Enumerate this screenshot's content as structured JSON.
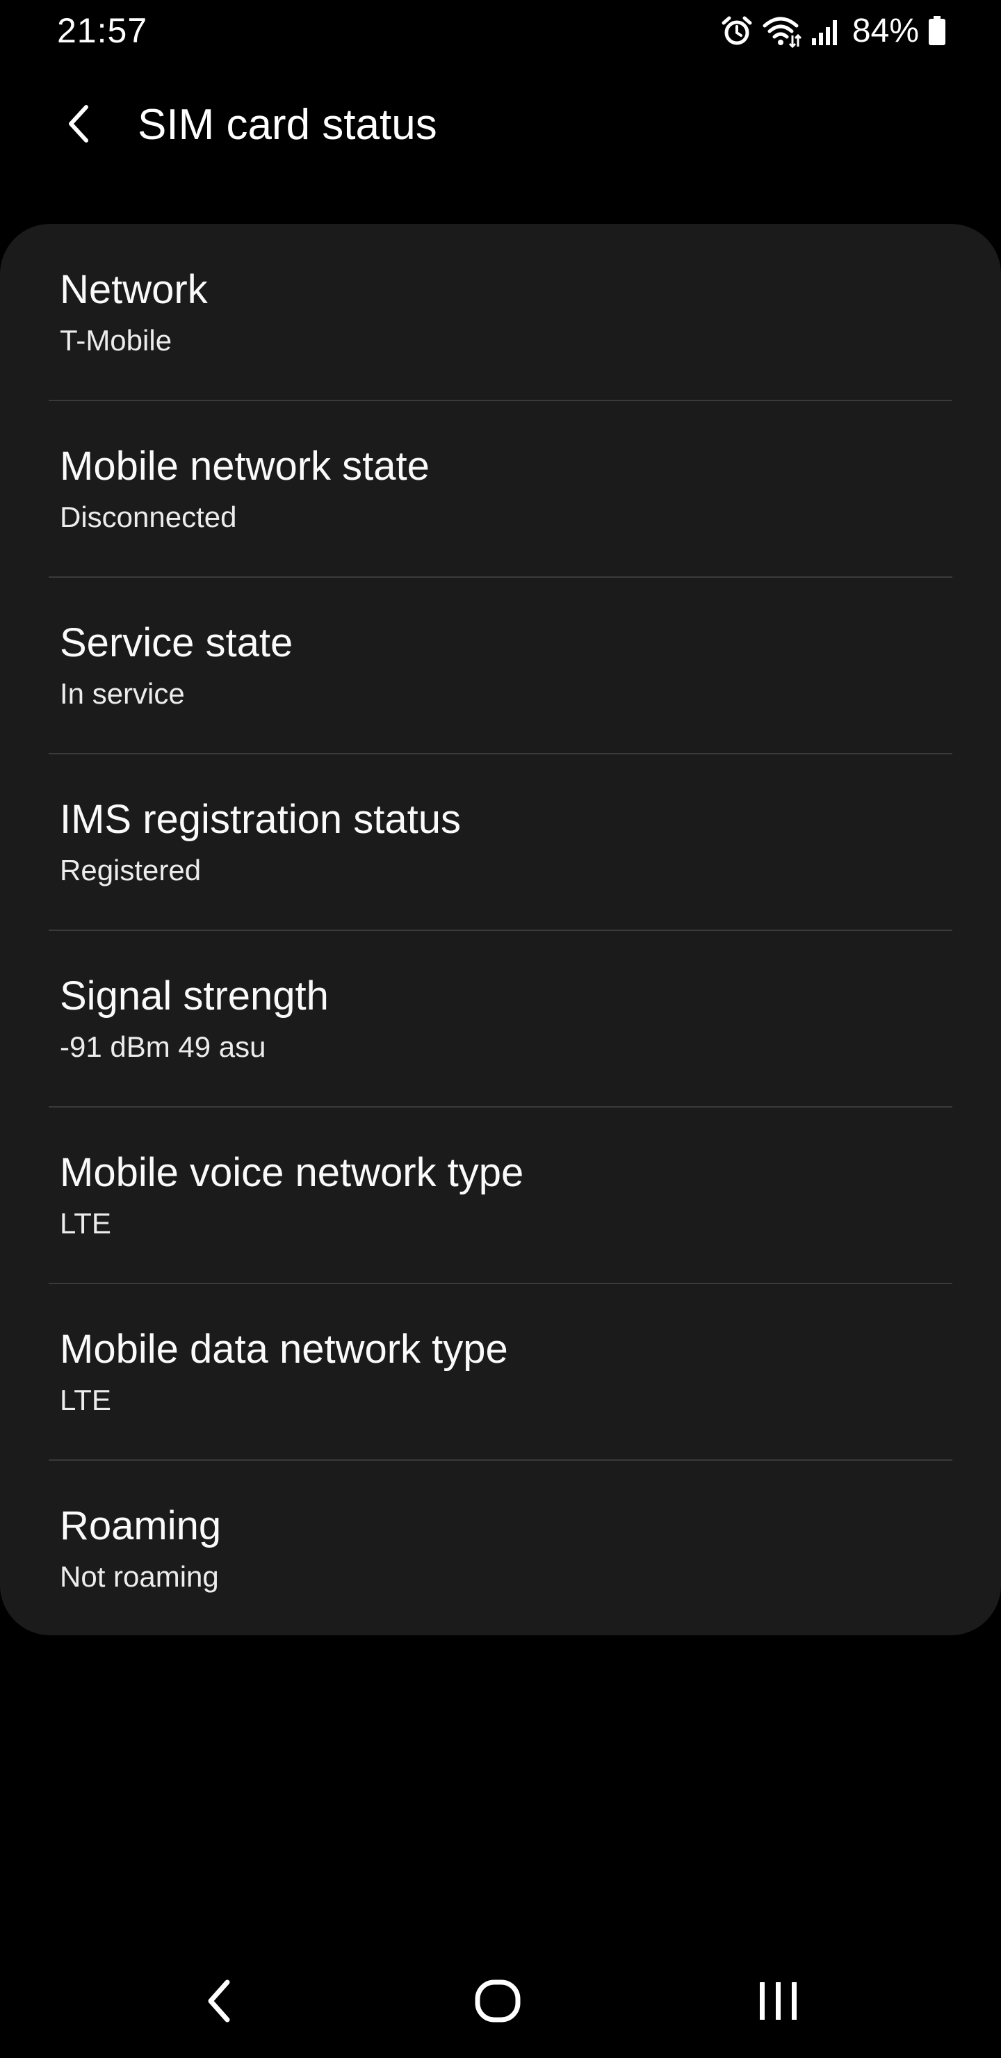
{
  "status_bar": {
    "time": "21:57",
    "battery_percent": "84%",
    "icons": [
      "alarm-icon",
      "wifi-icon",
      "signal-icon",
      "battery-icon"
    ]
  },
  "header": {
    "title": "SIM card status",
    "back_icon": "chevron-left-icon"
  },
  "items": [
    {
      "title": "Network",
      "value": "T-Mobile"
    },
    {
      "title": "Mobile network state",
      "value": "Disconnected"
    },
    {
      "title": "Service state",
      "value": "In service"
    },
    {
      "title": "IMS registration status",
      "value": "Registered"
    },
    {
      "title": "Signal strength",
      "value": "-91 dBm 49 asu"
    },
    {
      "title": "Mobile voice network type",
      "value": "LTE"
    },
    {
      "title": "Mobile data network type",
      "value": "LTE"
    },
    {
      "title": "Roaming",
      "value": "Not roaming"
    }
  ],
  "nav_bar": {
    "icons": [
      "back-icon",
      "home-icon",
      "recents-icon"
    ]
  },
  "colors": {
    "background": "#000000",
    "card": "#1b1b1b",
    "divider": "#3a3a3a",
    "text_primary": "#fafafa",
    "text_secondary": "#ececec"
  }
}
